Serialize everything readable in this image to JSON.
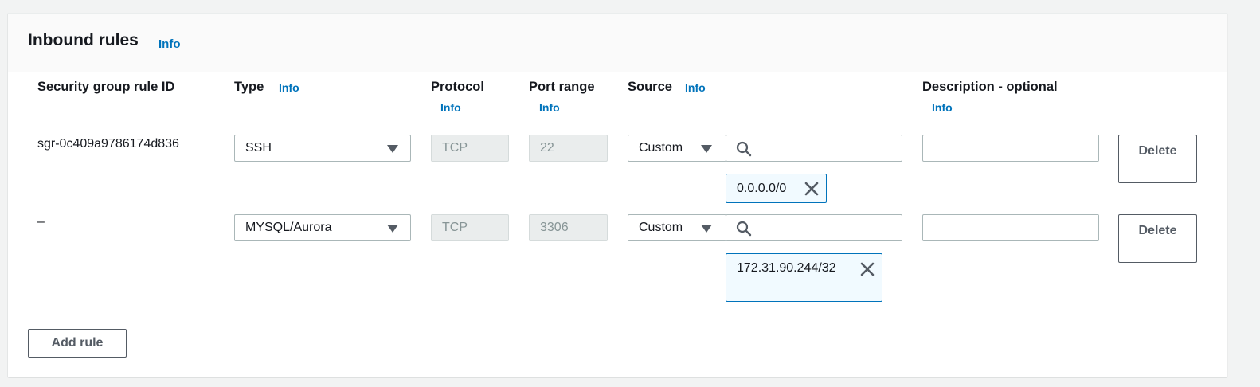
{
  "panel": {
    "title": "Inbound rules",
    "info_label": "Info"
  },
  "columns": [
    {
      "label": "Security group rule ID"
    },
    {
      "label": "Type",
      "info": "Info"
    },
    {
      "label": "Protocol",
      "info": "Info"
    },
    {
      "label": "Port range",
      "info": "Info"
    },
    {
      "label": "Source",
      "info": "Info"
    },
    {
      "label": "Description - optional",
      "info": "Info"
    }
  ],
  "rules": [
    {
      "rule_id": "sgr-0c409a9786174d836",
      "type": "SSH",
      "protocol": "TCP",
      "port_range": "22",
      "source_mode": "Custom",
      "source_search_value": "",
      "source_token": "0.0.0.0/0",
      "description": "",
      "delete_label": "Delete"
    },
    {
      "rule_id": "–",
      "type": "MYSQL/Aurora",
      "protocol": "TCP",
      "port_range": "3306",
      "source_mode": "Custom",
      "source_search_value": "",
      "source_token": "172.31.90.244/32",
      "description": "",
      "delete_label": "Delete"
    }
  ],
  "actions": {
    "add_rule_label": "Add rule"
  },
  "icons": {
    "search": "search-icon",
    "remove": "close-icon",
    "dropdown": "caret-down-icon"
  },
  "colors": {
    "link": "#0073bb",
    "token_border": "#0073bb",
    "token_background": "#f1faff",
    "disabled_background": "#eaeded"
  }
}
